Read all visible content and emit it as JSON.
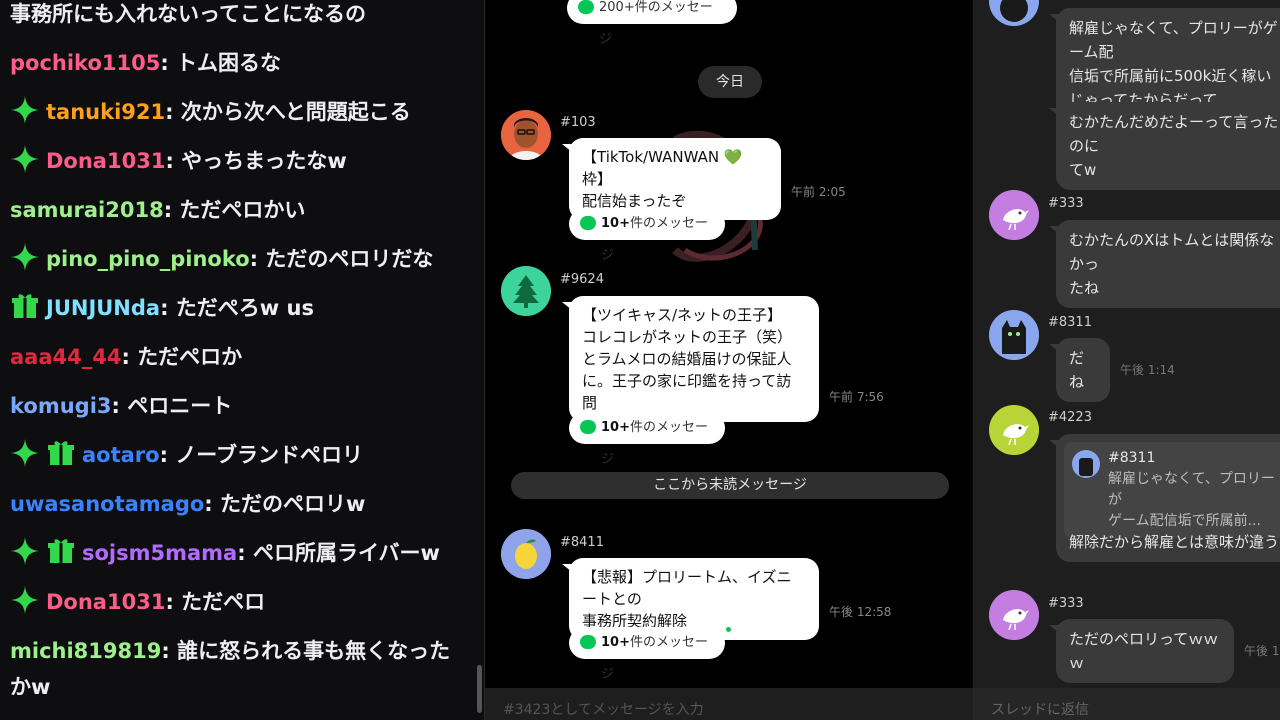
{
  "chat": {
    "messages": [
      {
        "user": "",
        "color": "#efeff1",
        "badges": [],
        "text": "事務所にも入れないってことになるの"
      },
      {
        "user": "pochiko1105",
        "color": "#ff5c8a",
        "badges": [],
        "text": "トム困るな"
      },
      {
        "user": "tanuki921",
        "color": "#ff9f1a",
        "badges": [
          "sparkle"
        ],
        "text": "次から次へと問題起こる"
      },
      {
        "user": "Dona1031",
        "color": "#ff5c8a",
        "badges": [
          "sparkle"
        ],
        "text": "やっちまったなw"
      },
      {
        "user": "samurai2018",
        "color": "#9ef08c",
        "badges": [],
        "text": "ただペロかい"
      },
      {
        "user": "pino_pino_pinoko",
        "color": "#9ef08c",
        "badges": [
          "sparkle"
        ],
        "text": "ただのペロリだな"
      },
      {
        "user": "JUNJUNda",
        "color": "#7fe0ff",
        "badges": [
          "gift"
        ],
        "text": "ただぺろw us"
      },
      {
        "user": "aaa44_44",
        "color": "#e0283e",
        "badges": [],
        "text": "ただペロか"
      },
      {
        "user": "komugi3",
        "color": "#7aa8ff",
        "badges": [],
        "text": "ペロニート"
      },
      {
        "user": "aotaro",
        "color": "#3b82ff",
        "badges": [
          "sparkle",
          "gift"
        ],
        "text": "ノーブランドペロリ"
      },
      {
        "user": "uwasanotamago",
        "color": "#3b82ff",
        "badges": [],
        "text": "ただのペロリw"
      },
      {
        "user": "sojsm5mama",
        "color": "#b26bff",
        "badges": [
          "sparkle",
          "gift"
        ],
        "text": "ペロ所属ライバーw"
      },
      {
        "user": "Dona1031",
        "color": "#ff5c8a",
        "badges": [
          "sparkle"
        ],
        "text": "ただペロ"
      },
      {
        "user": "michi819819",
        "color": "#9ef08c",
        "badges": [],
        "text": "誰に怒られる事も無くなった",
        "text2": "かw"
      }
    ]
  },
  "channel": {
    "top_pill": "200+件のメッセージ",
    "date_separator": "今日",
    "unread_label": "ここから未読メッセージ",
    "input_placeholder": "#3423としてメッセージを入力",
    "posts": [
      {
        "id": "#103",
        "lines": [
          "【TikTok/WANWAN 💚 枠】",
          "配信始まったぞ"
        ],
        "time": "午前 2:05",
        "replies": "10+",
        "replies_suffix": "件のメッセージ"
      },
      {
        "id": "#9624",
        "lines": [
          "【ツイキャス/ネットの王子】",
          "コレコレがネットの王子（笑）",
          "とラムメロの結婚届けの保証人",
          "に。王子の家に印鑑を持って訪問"
        ],
        "time": "午前 7:56",
        "replies": "10+",
        "replies_suffix": "件のメッセージ"
      },
      {
        "id": "#8411",
        "lines": [
          "【悲報】プロリートム、イズニートとの",
          "事務所契約解除"
        ],
        "time": "午後 12:58",
        "replies": "10+",
        "replies_suffix": "件のメッセージ"
      }
    ]
  },
  "thread": {
    "input_placeholder": "スレッドに返信",
    "top_lines": [
      "解雇じゃなくて、プロリーがゲーム配",
      "信垢で所属前に500k近く稼い",
      "じゃってたからだって"
    ],
    "second_lines": [
      "むかたんだめだよーって言ったのに",
      "てw"
    ],
    "posts": [
      {
        "id": "#333",
        "lines": [
          "むかたんのXはトムとは関係なかっ",
          "たね"
        ]
      },
      {
        "id": "#8311",
        "lines": [
          "だね"
        ],
        "time": "午後 1:14"
      },
      {
        "id": "#4223",
        "quote_id": "#8311",
        "quote_lines": [
          "解雇じゃなくて、プロリーが",
          "ゲーム配信垢で所属前..."
        ],
        "lines": [
          "解除だから解雇とは意味が違う"
        ]
      },
      {
        "id": "#333",
        "lines": [
          "ただのペロリってｗｗｗ"
        ],
        "time": "午後 1"
      }
    ]
  }
}
